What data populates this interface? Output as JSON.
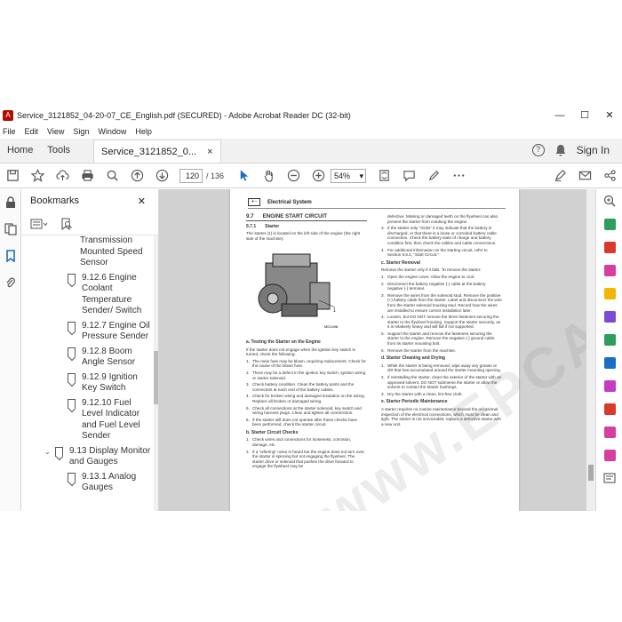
{
  "window": {
    "title": "Service_3121852_04-20-07_CE_English.pdf (SECURED) - Adobe Acrobat Reader DC (32-bit)",
    "minimize": "—",
    "maximize": "☐",
    "close": "✕"
  },
  "menu": [
    "File",
    "Edit",
    "View",
    "Sign",
    "Window",
    "Help"
  ],
  "tabs": {
    "home": "Home",
    "tools": "Tools",
    "document": "Service_3121852_0...",
    "document_close": "×",
    "sign_in": "Sign In"
  },
  "toolbar": {
    "page_current": "120",
    "page_total": "/ 136",
    "zoom": "54%"
  },
  "bookmarks": {
    "title": "Bookmarks",
    "close": "✕",
    "items": [
      {
        "text": "Transmission Mounted Speed Sensor",
        "indent": 2,
        "flag": false
      },
      {
        "text": "9.12.6 Engine Coolant Temperature Sender/ Switch",
        "indent": 1,
        "flag": true
      },
      {
        "text": "9.12.7 Engine Oil Pressure Sender",
        "indent": 1,
        "flag": true
      },
      {
        "text": "9.12.8 Boom Angle Sensor",
        "indent": 1,
        "flag": true
      },
      {
        "text": "9.12.9 Ignition Key Switch",
        "indent": 1,
        "flag": true
      },
      {
        "text": "9.12.10 Fuel Level Indicator and Fuel Level Sender",
        "indent": 1,
        "flag": true
      },
      {
        "text": "9.13 Display Monitor and Gauges",
        "indent": 0,
        "flag": true,
        "expanded": true
      },
      {
        "text": "9.13.1 Analog Gauges",
        "indent": 1,
        "flag": true
      }
    ]
  },
  "page": {
    "header": "Electrical System",
    "section_num": "9.7",
    "section_title": "ENGINE START CIRCUIT",
    "sub1_num": "9.7.1",
    "sub1_title": "Starter",
    "intro": "The starter (1) is located on the left side of the engine (the right side of the machine).",
    "figure_id": "MD1498",
    "testing_title": "a.   Testing the Starter on the Engine",
    "testing_intro": "If the starter does not engage when the ignition key switch is turned, check the following:",
    "testing_steps": [
      "The main fuse may be blown, requiring replacement. Check for the cause of the blown fuse.",
      "There may be a defect in the ignition key switch, ignition wiring or starter solenoid.",
      "Check battery condition. Clean the battery posts and the connectors at each end of the battery cables.",
      "Check for broken wiring and damaged insulation on the wiring. Replace all broken or damaged wiring.",
      "Check all connections at the starter solenoid, key switch and wiring harness plugs. Clean and tighten all connections.",
      "If the starter still does not operate after these checks have been performed, check the starter circuit."
    ],
    "circuit_title": "b.   Starter Circuit Checks",
    "circuit_steps": [
      "Check wires and connections for looseness, corrosion, damage, etc.",
      "If a \"whirring\" noise is heard but the engine does not turn over, the starter is spinning but not engaging the flywheel. The starter drive or solenoid that pushes the drive forward to engage the flywheel may be"
    ],
    "right_cont": "defective. Missing or damaged teeth on the flywheel can also prevent the starter from cranking the engine.",
    "right_steps": [
      "If the starter only \"clicks\" it may indicate that the battery is discharged, or that there is a loose or corroded battery cable connection. Check the battery state of charge and battery condition first, then check the cables and cable connections.",
      "For additional information on the starting circuit, refer to Section 9.6.2, \"Start Circuit.\""
    ],
    "removal_title": "c.   Starter Removal",
    "removal_intro": "Remove the starter only if it fails. To remove the starter:",
    "removal_steps": [
      "Open the engine cover. Allow the engine to cool.",
      "Disconnect the battery negative (-) cable at the battery negative (-) terminal.",
      "Remove the wires from the solenoid stud. Remove the positive (+) battery cable from the starter. Label and disconnect the wire from the starter solenoid housing stud. Record how the wires are installed to ensure correct installation later.",
      "Loosen, but DO NOT remove the three fasteners securing the starter to the flywheel housing. Support the starter securely, as it is relatively heavy and will fall if not supported.",
      "Support the starter and remove the fasteners securing the starter to the engine. Remove the negative (-) ground cable from its starter mounting bolt.",
      "Remove the starter from the machine."
    ],
    "cleaning_title": "d.   Starter Cleaning and Drying",
    "cleaning_steps": [
      "While the starter is being removed, wipe away any grease or dirt that has accumulated around the starter mounting opening.",
      "If reinstalling the starter, clean the exterior of the starter with an approved solvent. DO NOT submerse the starter or allow the solvent to contact the starter bushings.",
      "Dry the starter with a clean, lint-free cloth."
    ],
    "maintenance_title": "e.   Starter Periodic Maintenance",
    "maintenance_text": "A starter requires no routine maintenance beyond the occasional inspection of the electrical connections, which must be clean and tight. The starter is not serviceable; replace a defective starter with a new unit.",
    "watermark": "www.EPCA.com"
  },
  "colors": {
    "accent_blue": "#1a6cc5",
    "acrobat_red": "#b30b00"
  }
}
